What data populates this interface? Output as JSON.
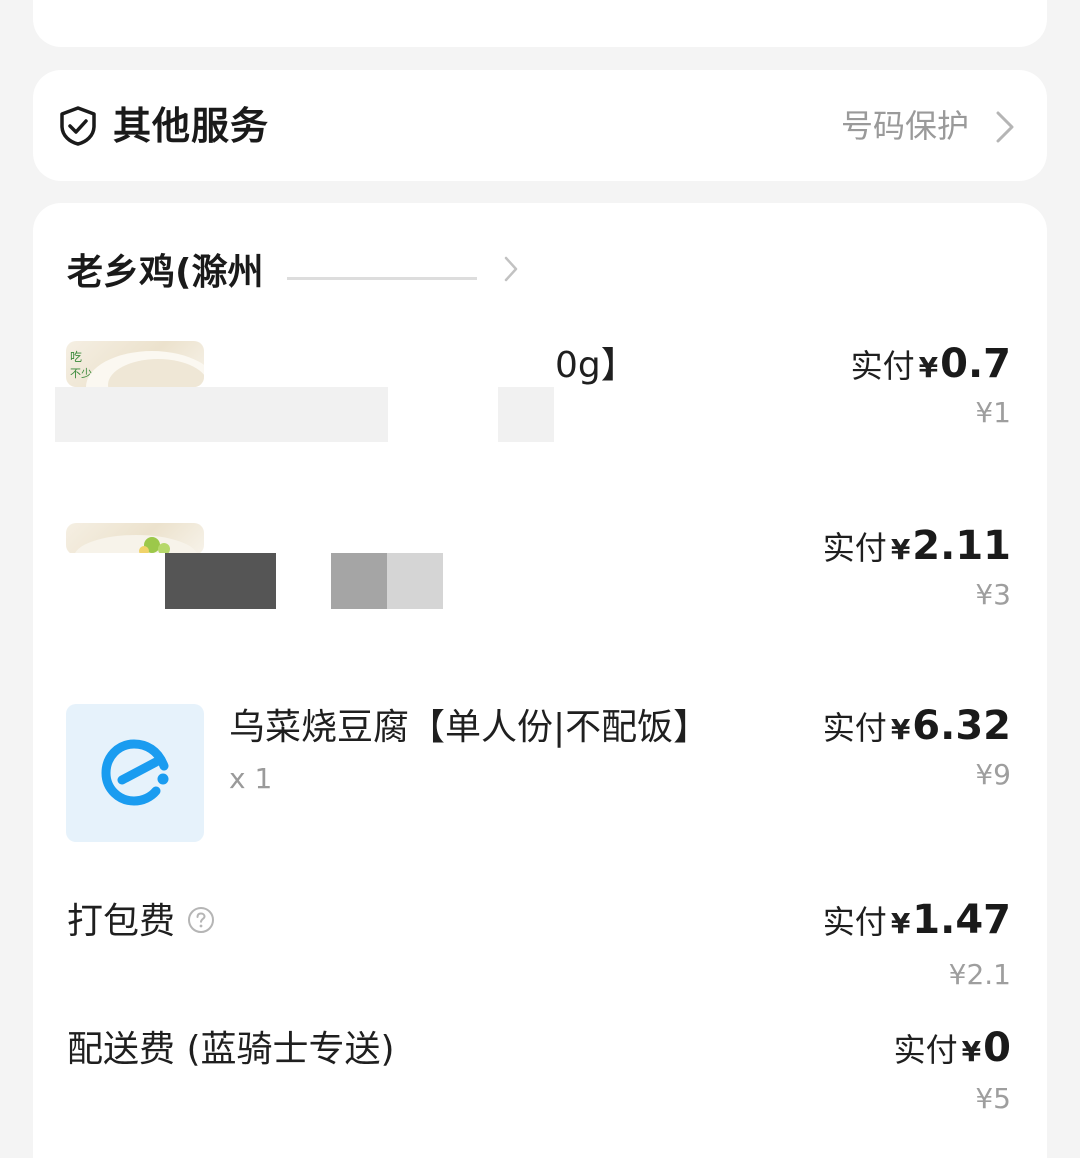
{
  "service": {
    "title": "其他服务",
    "right_text": "号码保护",
    "icon": "shield-check-icon"
  },
  "store": {
    "name": "老乡鸡(滁州"
  },
  "items": [
    {
      "name_visible": "0g】",
      "pay_label": "实付",
      "pay_symbol": "¥",
      "pay_value": "0.7",
      "original_price": "¥1",
      "thumb_text": "吃不少"
    },
    {
      "pay_label": "实付",
      "pay_symbol": "¥",
      "pay_value": "2.11",
      "original_price": "¥3"
    },
    {
      "name": "乌菜烧豆腐【单人份|不配饭】",
      "qty": "x 1",
      "pay_label": "实付",
      "pay_symbol": "¥",
      "pay_value": "6.32",
      "original_price": "¥9",
      "thumb_icon": "eleme-logo-icon"
    }
  ],
  "fees": [
    {
      "label": "打包费",
      "pay_label": "实付",
      "pay_symbol": "¥",
      "pay_value": "1.47",
      "original_price": "¥2.1",
      "icon": "help-circle-icon"
    },
    {
      "label": "配送费 (蓝骑士专送)",
      "pay_label": "实付",
      "pay_symbol": "¥",
      "pay_value": "0",
      "original_price": "¥5"
    }
  ],
  "colors": {
    "background": "#f4f4f4",
    "card": "#ffffff",
    "secondary_text": "#9a9a9a",
    "brand_blue": "#1a9cf0"
  }
}
